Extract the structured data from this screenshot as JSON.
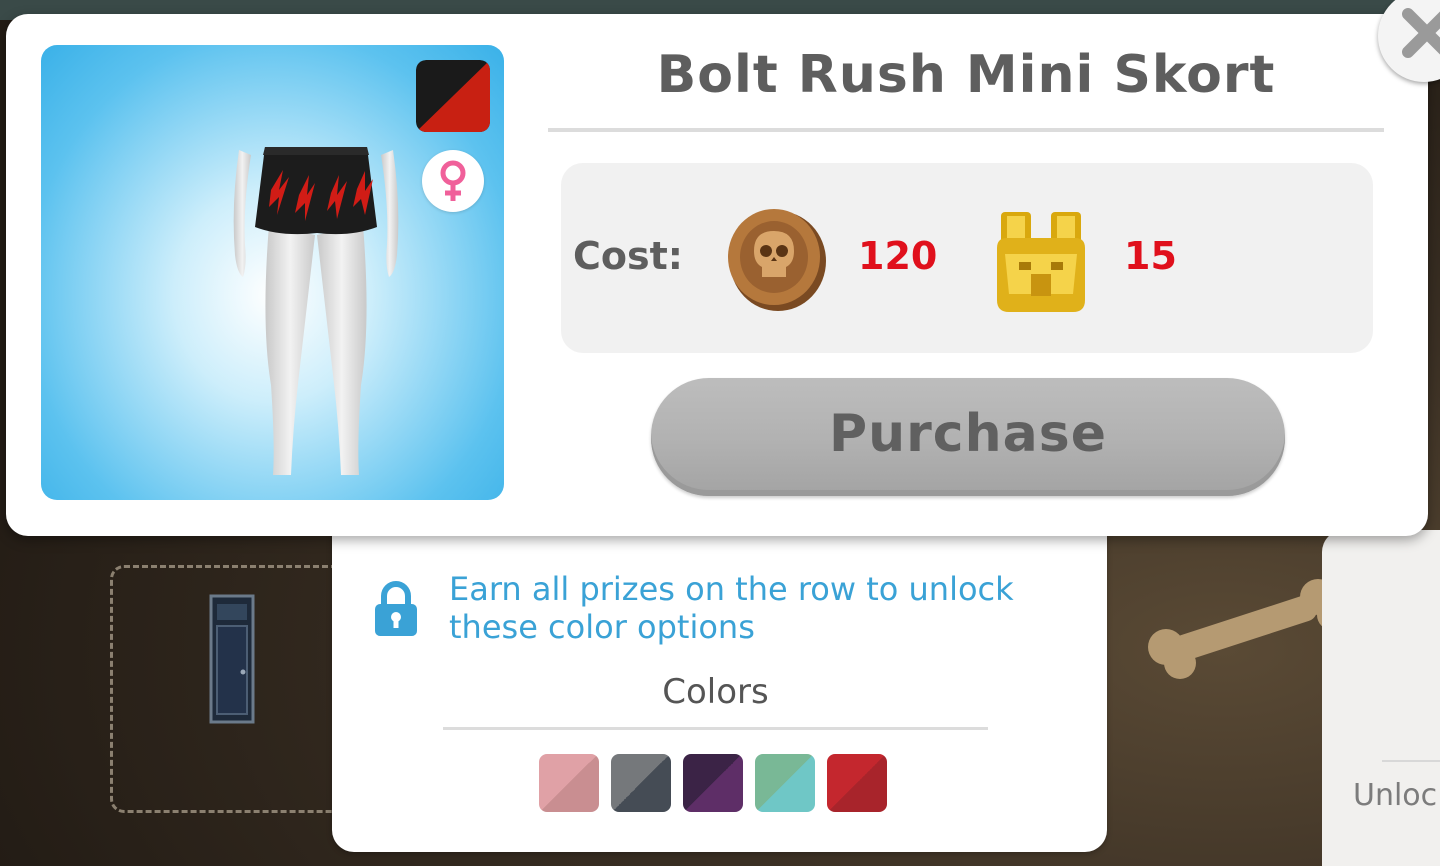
{
  "item": {
    "title": "Bolt Rush Mini Skort",
    "selected_color": [
      "#1a1a1a",
      "#c82012"
    ]
  },
  "cost": {
    "label": "Cost:",
    "entries": [
      {
        "currency_icon": "skull-coin-icon",
        "value": "120"
      },
      {
        "currency_icon": "golden-idol-icon",
        "value": "15"
      }
    ]
  },
  "purchase": {
    "label": "Purchase"
  },
  "colors_panel": {
    "unlock_message": "Earn all prizes on the row to unlock these color options",
    "heading": "Colors",
    "swatches": [
      {
        "name": "pink",
        "colors": [
          "#e0a1a6",
          "#c98e91"
        ]
      },
      {
        "name": "slate",
        "colors": [
          "#75787b",
          "#454c55"
        ]
      },
      {
        "name": "purple",
        "colors": [
          "#3b2346",
          "#5e2e67"
        ]
      },
      {
        "name": "teal",
        "colors": [
          "#79b896",
          "#6fc7c6"
        ]
      },
      {
        "name": "red",
        "colors": [
          "#c4272e",
          "#a8242b"
        ]
      }
    ]
  },
  "background": {
    "side_panel_text": "Unloc"
  },
  "colors": {
    "accent_blue": "#3aa2d6",
    "cost_red": "#e0101c",
    "button_gray": "#b1b1b1"
  }
}
